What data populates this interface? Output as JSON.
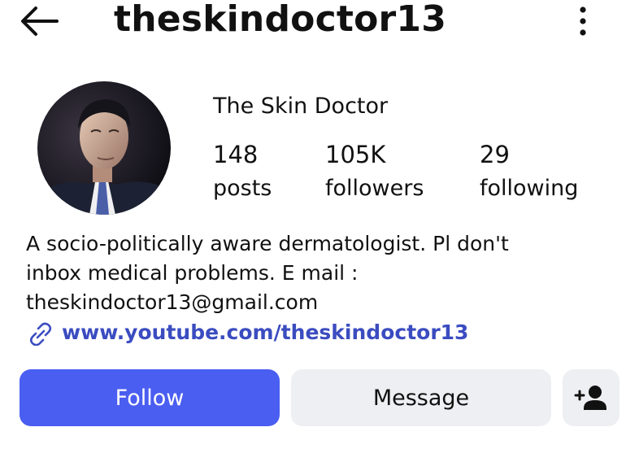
{
  "header": {
    "username": "theskindoctor13",
    "back_icon": "arrow-left-icon",
    "more_icon": "vertical-ellipsis-icon"
  },
  "profile": {
    "avatar_icon": "profile-photo",
    "display_name": "The Skin Doctor",
    "stats": {
      "posts": {
        "value": "148",
        "label": "posts"
      },
      "followers": {
        "value": "105K",
        "label": "followers"
      },
      "following": {
        "value": "29",
        "label": "following"
      }
    },
    "bio": "A socio-politically aware dermatologist. Pl don't\ninbox medical problems. E mail :\ntheskindoctor13@gmail.com",
    "link": {
      "icon": "link-icon",
      "text": "www.youtube.com/theskindoctor13",
      "color": "#3b4cc0"
    }
  },
  "actions": {
    "follow_label": "Follow",
    "message_label": "Message",
    "add_user_icon": "add-person-icon",
    "follow_color": "#4a5ef1",
    "secondary_color": "#eeeff2"
  }
}
